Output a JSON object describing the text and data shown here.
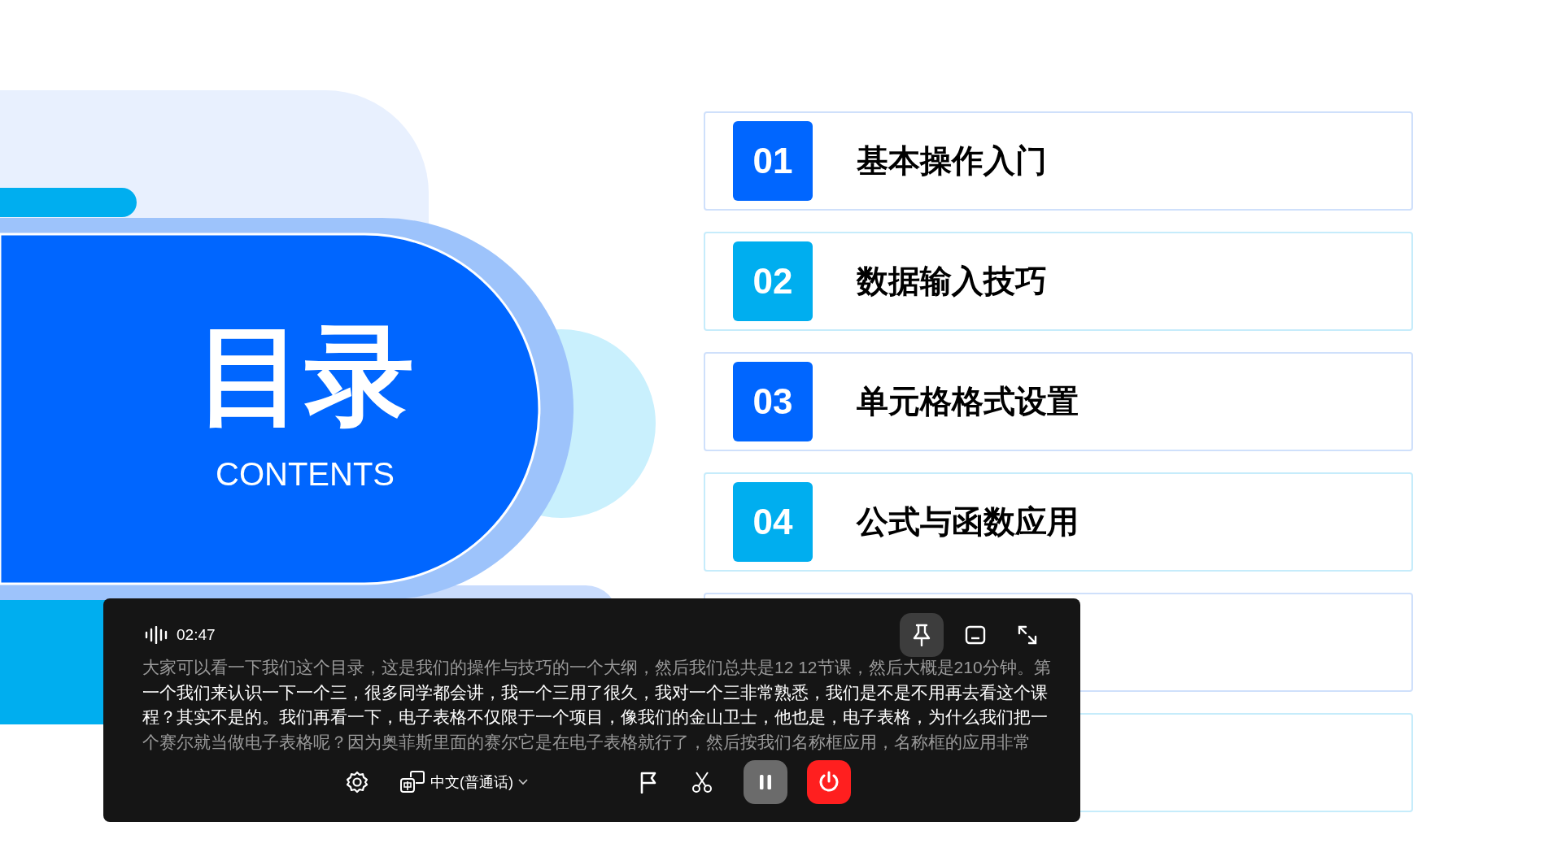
{
  "slide": {
    "heading": "目录",
    "subheading": "CONTENTS",
    "items": [
      {
        "kind": "entry",
        "number": "01",
        "title": "基本操作入门",
        "color": "#0066ff"
      },
      {
        "kind": "entry",
        "number": "02",
        "title": "数据输入技巧",
        "color": "#00aeef"
      },
      {
        "kind": "entry",
        "number": "03",
        "title": "单元格格式设置",
        "color": "#0066ff"
      },
      {
        "kind": "entry",
        "number": "04",
        "title": "公式与函数应用",
        "color": "#00aeef"
      },
      {
        "kind": "blank"
      },
      {
        "kind": "blank"
      }
    ]
  },
  "caption_panel": {
    "elapsed": "02:47",
    "pinned": true,
    "lines": [
      {
        "text": "大家可以看一下我们这个目录，这是我们的操作与技巧的一个大纲，然后我们总共是12 12节课，然后大概是210分钟。第",
        "faded": true
      },
      {
        "text": "一个我们来认识一下一个三，很多同学都会讲，我一个三用了很久，我对一个三非常熟悉，我们是不是不用再去看这个课",
        "faded": false
      },
      {
        "text": "程？其实不是的。我们再看一下，电子表格不仅限于一个项目，像我们的金山卫士，他也是，电子表格，为什么我们把一",
        "faded": false
      },
      {
        "text": "个赛尔就当做电子表格呢？因为奥菲斯里面的赛尔它是在电子表格就行了，然后按我们名称框应用，名称框的应用非常",
        "faded": true
      }
    ],
    "language": "中文(普通话)"
  }
}
